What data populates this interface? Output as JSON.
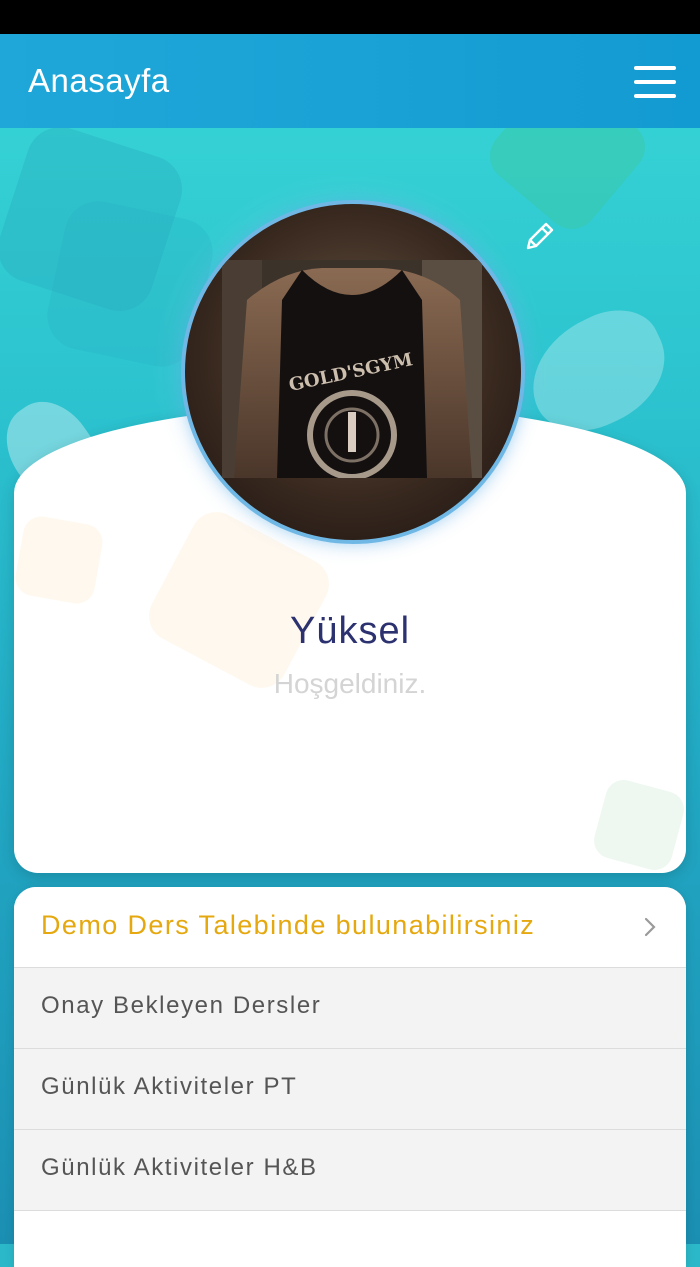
{
  "header": {
    "title": "Anasayfa",
    "menu_icon": "hamburger-menu-icon"
  },
  "profile": {
    "name": "Yüksel",
    "greeting": "Hoşgeldiniz.",
    "edit_icon": "pencil-icon",
    "avatar": "profile-photo"
  },
  "menu": {
    "items": [
      {
        "label": "Demo Ders Talebinde bulunabilirsiniz",
        "highlight": true
      },
      {
        "label": "Onay Bekleyen Dersler"
      },
      {
        "label": "Günlük Aktiviteler PT"
      },
      {
        "label": "Günlük Aktiviteler H&B"
      }
    ]
  },
  "colors": {
    "header": "#1aa2d6",
    "accent": "#e5a80f",
    "name": "#2c3170"
  }
}
